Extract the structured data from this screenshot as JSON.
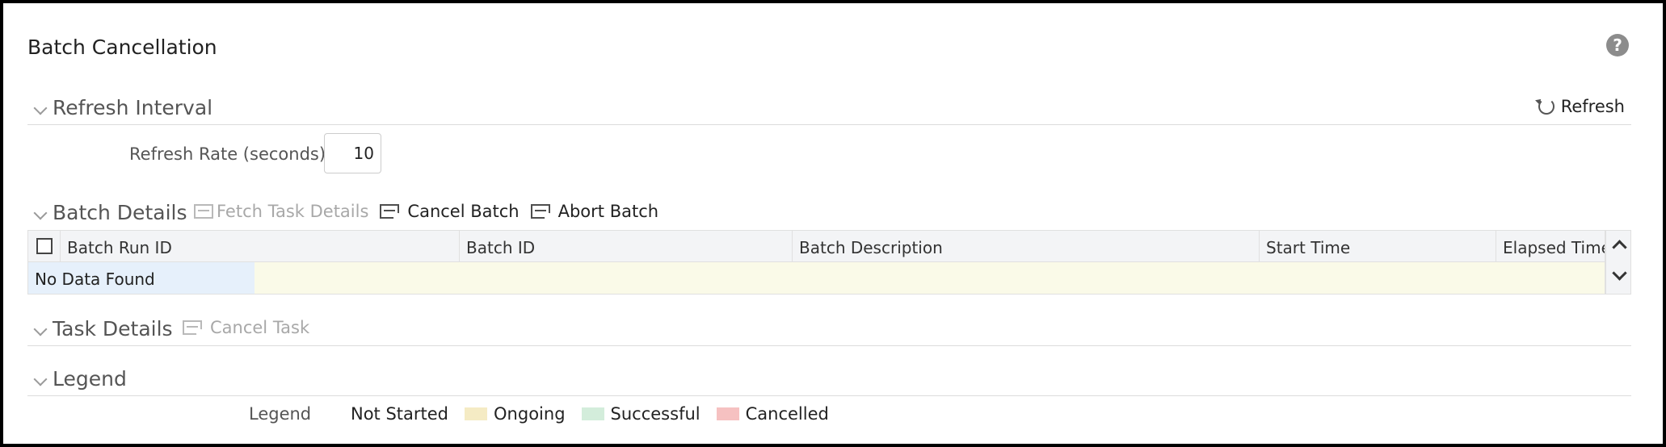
{
  "page": {
    "title": "Batch Cancellation"
  },
  "refresh_interval": {
    "title": "Refresh Interval",
    "refresh_label": "Refresh",
    "rate_label": "Refresh Rate (seconds)",
    "rate_value": "10"
  },
  "batch_details": {
    "title": "Batch Details",
    "toolbar": {
      "fetch_task_details": "Fetch Task Details",
      "cancel_batch": "Cancel Batch",
      "abort_batch": "Abort Batch"
    },
    "columns": [
      "Batch Run ID",
      "Batch ID",
      "Batch Description",
      "Start Time",
      "Elapsed Time"
    ],
    "empty_text": "No Data Found"
  },
  "task_details": {
    "title": "Task Details",
    "cancel_task": "Cancel Task"
  },
  "legend": {
    "title": "Legend",
    "label": "Legend",
    "items": [
      {
        "label": "Not Started",
        "color": ""
      },
      {
        "label": "Ongoing",
        "color": "#f5ebc4"
      },
      {
        "label": "Successful",
        "color": "#d3eddb"
      },
      {
        "label": "Cancelled",
        "color": "#f6c1c1"
      }
    ]
  },
  "icons": {
    "help": "help-icon",
    "refresh": "refresh-icon",
    "collapse": "chevron-down-icon",
    "grid_action": "grid-cancel-icon",
    "scroll_up": "chevron-up-icon",
    "scroll_down": "chevron-down-icon"
  }
}
